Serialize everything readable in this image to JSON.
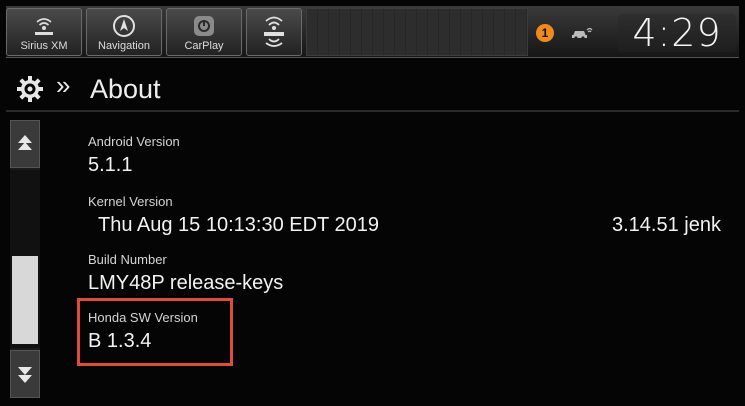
{
  "topbar": {
    "tiles": [
      {
        "label": "Sirius XM",
        "icon": "siriusxm-logo-icon"
      },
      {
        "label": "Navigation",
        "icon": "compass-icon"
      },
      {
        "label": "CarPlay",
        "icon": "carplay-icon"
      },
      {
        "label": "",
        "icon": "siriusxm-signal-icon"
      }
    ],
    "alert_count": "1",
    "clock": "4:29"
  },
  "header": {
    "title": "About",
    "breadcrumb_separator": "»"
  },
  "info": [
    {
      "label": "Android Version",
      "value": "5.1.1"
    },
    {
      "label": "Kernel Version",
      "value": "Thu Aug 15 10:13:30 EDT 2019",
      "value2": "3.14.51 jenk"
    },
    {
      "label": "Build Number",
      "value": "LMY48P release-keys"
    },
    {
      "label": "Honda SW Version",
      "value": "B 1.3.4"
    }
  ],
  "colors": {
    "highlight": "#e14b3b",
    "alert": "#f08a1c"
  }
}
